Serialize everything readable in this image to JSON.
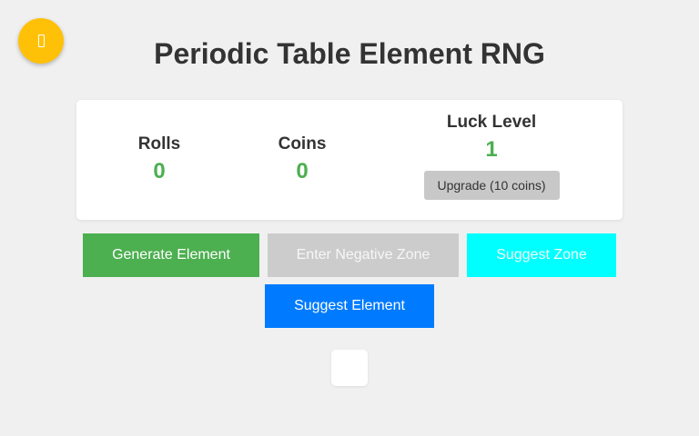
{
  "title": "Periodic Table Element RNG",
  "fab": {
    "icon": "coin-icon"
  },
  "stats": {
    "rolls_label": "Rolls",
    "rolls_value": "0",
    "coins_label": "Coins",
    "coins_value": "0",
    "luck_label": "Luck Level",
    "luck_value": "1",
    "upgrade_label": "Upgrade (10 coins)"
  },
  "buttons": {
    "generate": "Generate Element",
    "negative_zone": "Enter Negative Zone",
    "suggest_zone": "Suggest Zone",
    "suggest_element": "Suggest Element"
  },
  "colors": {
    "accent_green": "#4caf50",
    "fab_yellow": "#ffc107",
    "cyan": "#00ffff",
    "blue": "#007bff",
    "disabled_gray": "#cccccc"
  }
}
